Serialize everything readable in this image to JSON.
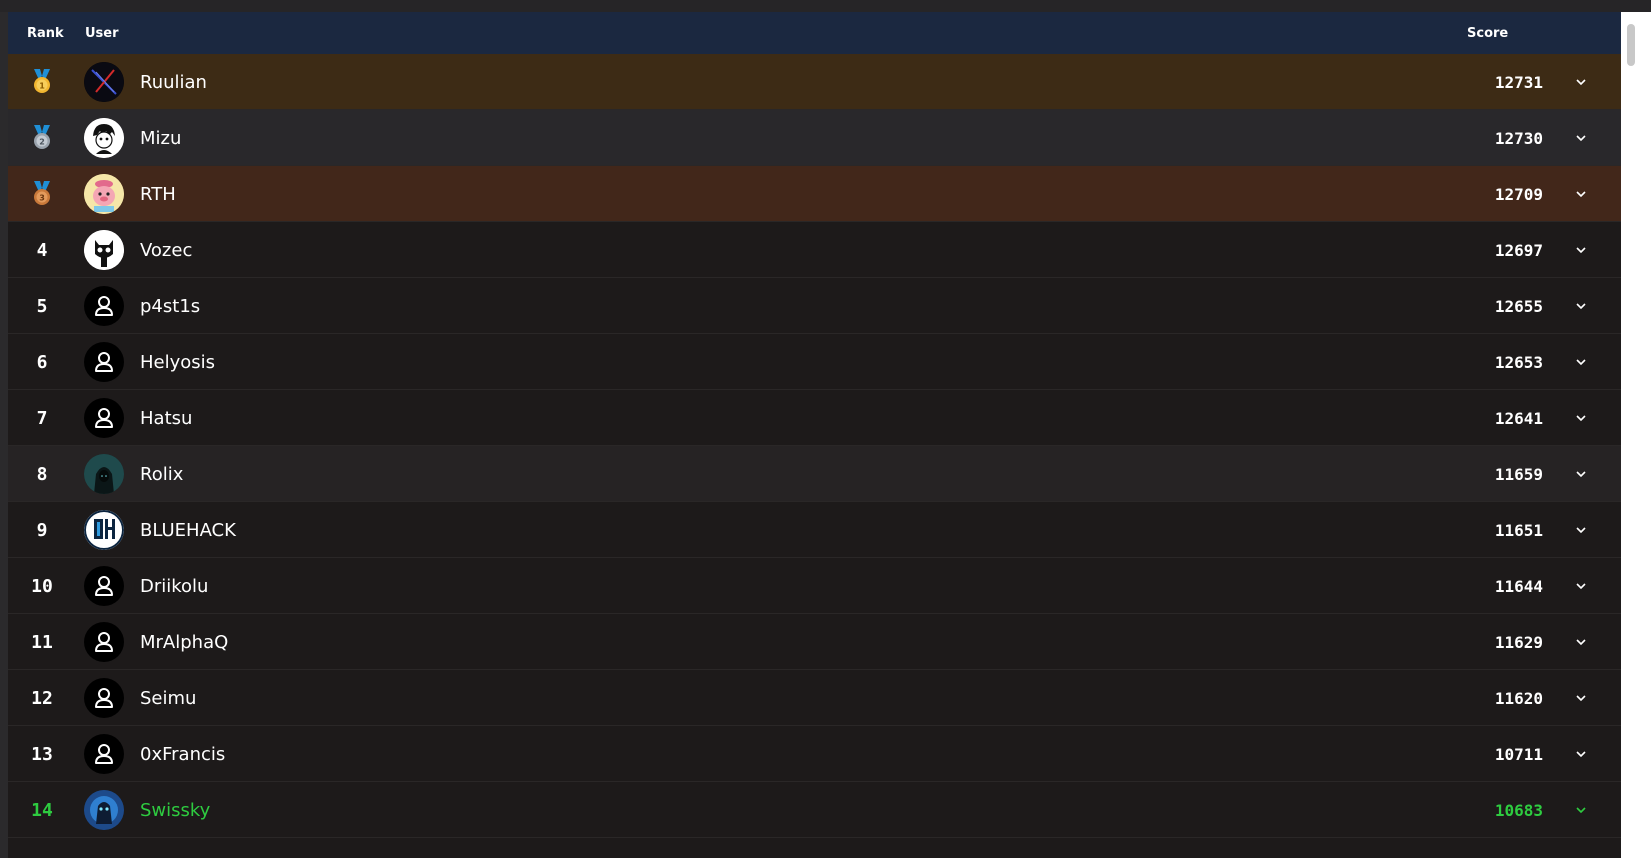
{
  "header": {
    "rank": "Rank",
    "user": "User",
    "score": "Score"
  },
  "colors": {
    "accent_me": "#2ecc40",
    "gold_row": "#3d2b15",
    "bronze_row": "#42271a",
    "header_bg": "#1b2840"
  },
  "rows": [
    {
      "rank": "",
      "medal": "gold",
      "medal_num": "1",
      "avatar": "custom",
      "name": "Ruulian",
      "score": "12731"
    },
    {
      "rank": "",
      "medal": "silver",
      "medal_num": "2",
      "avatar": "custom",
      "name": "Mizu",
      "score": "12730"
    },
    {
      "rank": "",
      "medal": "bronze",
      "medal_num": "3",
      "avatar": "custom",
      "name": "RTH",
      "score": "12709"
    },
    {
      "rank": "4",
      "avatar": "custom",
      "name": "Vozec",
      "score": "12697"
    },
    {
      "rank": "5",
      "avatar": "default-user-icon",
      "name": "p4st1s",
      "score": "12655"
    },
    {
      "rank": "6",
      "avatar": "default-user-icon",
      "name": "Helyosis",
      "score": "12653"
    },
    {
      "rank": "7",
      "avatar": "default-user-icon",
      "name": "Hatsu",
      "score": "12641"
    },
    {
      "rank": "8",
      "avatar": "custom",
      "name": "Rolix",
      "score": "11659"
    },
    {
      "rank": "9",
      "avatar": "custom",
      "name": "BLUEHACK",
      "score": "11651"
    },
    {
      "rank": "10",
      "avatar": "default-user-icon",
      "name": "Driikolu",
      "score": "11644"
    },
    {
      "rank": "11",
      "avatar": "default-user-icon",
      "name": "MrAlphaQ",
      "score": "11629"
    },
    {
      "rank": "12",
      "avatar": "default-user-icon",
      "name": "Seimu",
      "score": "11620"
    },
    {
      "rank": "13",
      "avatar": "default-user-icon",
      "name": "0xFrancis",
      "score": "10711"
    },
    {
      "rank": "14",
      "avatar": "custom",
      "name": "Swissky",
      "score": "10683",
      "current_user": true
    }
  ]
}
